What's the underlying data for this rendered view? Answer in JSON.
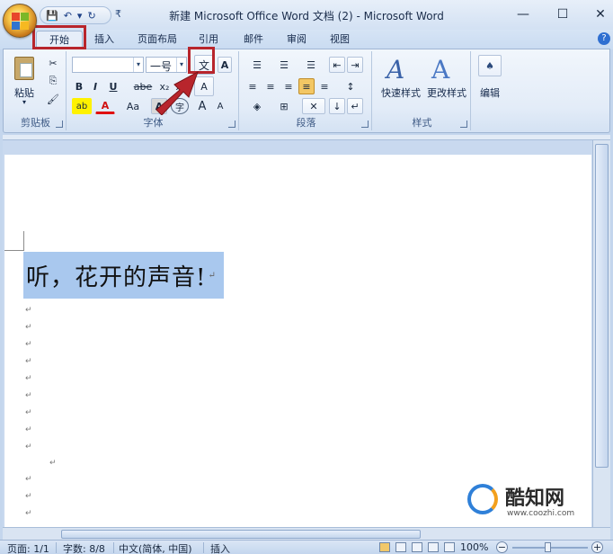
{
  "window": {
    "title": "新建 Microsoft Office Word 文档 (2) - Microsoft Word",
    "minimize": "—",
    "maximize": "☐",
    "close": "✕"
  },
  "qat": {
    "save": "💾",
    "undo": "↶",
    "undo_more": "▾",
    "redo": "↻",
    "customize": "₹"
  },
  "tabs": [
    {
      "label": "开始",
      "active": true
    },
    {
      "label": "插入"
    },
    {
      "label": "页面布局"
    },
    {
      "label": "引用"
    },
    {
      "label": "邮件"
    },
    {
      "label": "审阅"
    },
    {
      "label": "视图"
    }
  ],
  "ribbon": {
    "clipboard": {
      "label": "剪贴板",
      "paste": "粘贴",
      "paste_arrow": "▾",
      "cut": "✂",
      "copy": "⎘",
      "format_painter": "🖌"
    },
    "font": {
      "label": "字体",
      "font_name": "",
      "font_size": "一号",
      "pinyin": "文",
      "char_border": "A",
      "bold": "B",
      "italic": "I",
      "underline": "U",
      "strike": "abe",
      "subscript": "x₂",
      "superscript": "x²",
      "clear_format": "A",
      "highlight": "ab",
      "font_color": "A",
      "change_case": "Aa",
      "char_shading": "A",
      "enclose": "字",
      "grow": "A",
      "shrink": "A"
    },
    "paragraph": {
      "label": "段落",
      "bullets": "☰",
      "numbering": "☰",
      "multilevel": "☰",
      "decrease_indent": "⇤",
      "increase_indent": "⇥",
      "sort": "↓",
      "show_marks": "↵",
      "line_spacing": "↕"
    },
    "styles": {
      "label": "样式",
      "quick_styles": "快速样式",
      "change_styles": "更改样式"
    },
    "editing": {
      "label": "编辑",
      "edit": "编辑"
    }
  },
  "document": {
    "text": "听，花开的声音!",
    "para_mark": "↵"
  },
  "watermark": {
    "brand": "酷知网",
    "url": "www.coozhi.com"
  },
  "status": {
    "page": "页面: 1/1",
    "words": "字数: 8/8",
    "language": "中文(简体, 中国)",
    "mode": "插入",
    "zoom": "100%",
    "zoom_out": "−",
    "zoom_in": "+"
  },
  "colors": {
    "highlight_box": "#b8252c",
    "selection": "#a9c8ee",
    "arrow": "#b8252c"
  }
}
